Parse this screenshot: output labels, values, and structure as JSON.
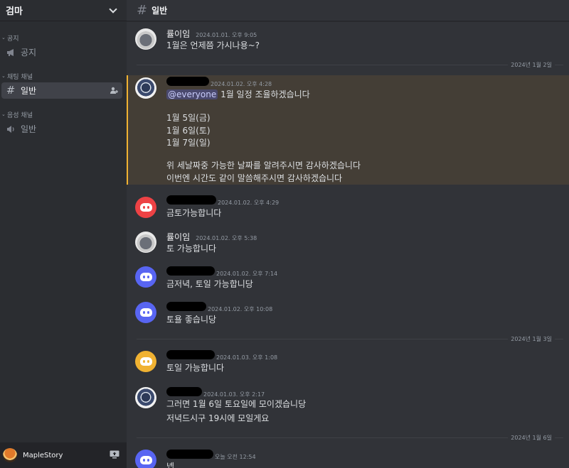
{
  "server": {
    "name": "검마"
  },
  "sidebar": {
    "categories": [
      {
        "label": "공지",
        "channels": [
          {
            "label": "공지",
            "type": "announcement"
          }
        ]
      },
      {
        "label": "채팅 채널",
        "channels": [
          {
            "label": "일반",
            "type": "text",
            "active": true
          }
        ]
      },
      {
        "label": "음성 채널",
        "channels": [
          {
            "label": "일반",
            "type": "voice"
          }
        ]
      }
    ]
  },
  "user_panel": {
    "name": "MapleStory"
  },
  "channel_header": {
    "title": "일반"
  },
  "messages": [
    {
      "author": "률이임",
      "timestamp": "2024.01.01. 오후 9:05",
      "lines": [
        "1월은 언제쯤 가시나용~?"
      ]
    },
    {
      "author": "",
      "timestamp": "2024.01.02. 오후 4:28",
      "mention": "@everyone",
      "lines": [
        "1월 일정 조율하겠습니다",
        "1월 5일(금)",
        "1월 6일(토)",
        "1월 7일(일)",
        "위 세날짜중 가능한 날짜를 알려주시면 감사하겠습니다",
        "이번엔 시간도 같이 말씀해주시면 감사하겠습니다"
      ]
    },
    {
      "author": "",
      "timestamp": "2024.01.02. 오후 4:29",
      "lines": [
        "금토가능합니다"
      ]
    },
    {
      "author": "률이임",
      "timestamp": "2024.01.02. 오후 5:38",
      "lines": [
        "토 가능합니다"
      ]
    },
    {
      "author": "",
      "timestamp": "2024.01.02. 오후 7:14",
      "lines": [
        "금저녁, 토일 가능합니당"
      ]
    },
    {
      "author": "",
      "timestamp": "2024.01.02. 오후 10:08",
      "lines": [
        "토욜 좋습니당"
      ]
    },
    {
      "author": "",
      "timestamp": "2024.01.03. 오후 1:08",
      "lines": [
        "토일 가능합니다"
      ]
    },
    {
      "author": "",
      "timestamp": "2024.01.03. 오후 2:17",
      "lines": [
        "그러면 1월 6일 토요일에 모이겠습니당",
        "저녁드시구 19시에 모일게요"
      ]
    },
    {
      "author": "",
      "timestamp": "오늘 오전 12:54",
      "lines": [
        "넵"
      ]
    }
  ],
  "dividers": [
    "2024년 1월 2일",
    "2024년 1월 3일",
    "2024년 1월 6일"
  ],
  "colors": {
    "discord_red": "#ed4245",
    "discord_blurple": "#5865f2",
    "discord_yellow": "#f0b232",
    "highlight_border": "#f0b232"
  }
}
